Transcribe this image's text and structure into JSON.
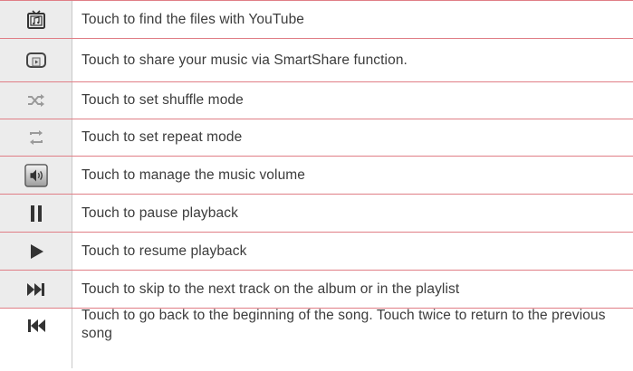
{
  "rows": [
    {
      "icon": "youtube-tv-icon",
      "text": "Touch to find the files with YouTube"
    },
    {
      "icon": "smartshare-icon",
      "text": "Touch to share your music via SmartShare function."
    },
    {
      "icon": "shuffle-icon",
      "text": "Touch to set shuffle mode"
    },
    {
      "icon": "repeat-icon",
      "text": "Touch to set repeat mode"
    },
    {
      "icon": "volume-icon",
      "text": "Touch to manage the music volume"
    },
    {
      "icon": "pause-icon",
      "text": "Touch to pause playback"
    },
    {
      "icon": "play-icon",
      "text": "Touch to resume playback"
    },
    {
      "icon": "skip-next-icon",
      "text": "Touch to skip to the next track on the album or in the playlist"
    },
    {
      "icon": "skip-previous-icon",
      "text": "Touch to go back to the beginning of the song. Touch twice to return to the previous song"
    }
  ],
  "colors": {
    "row_border": "#e07e86",
    "icon_cell_bg": "#ececec",
    "icon_dark": "#333333",
    "icon_light": "#b0b0b0"
  }
}
